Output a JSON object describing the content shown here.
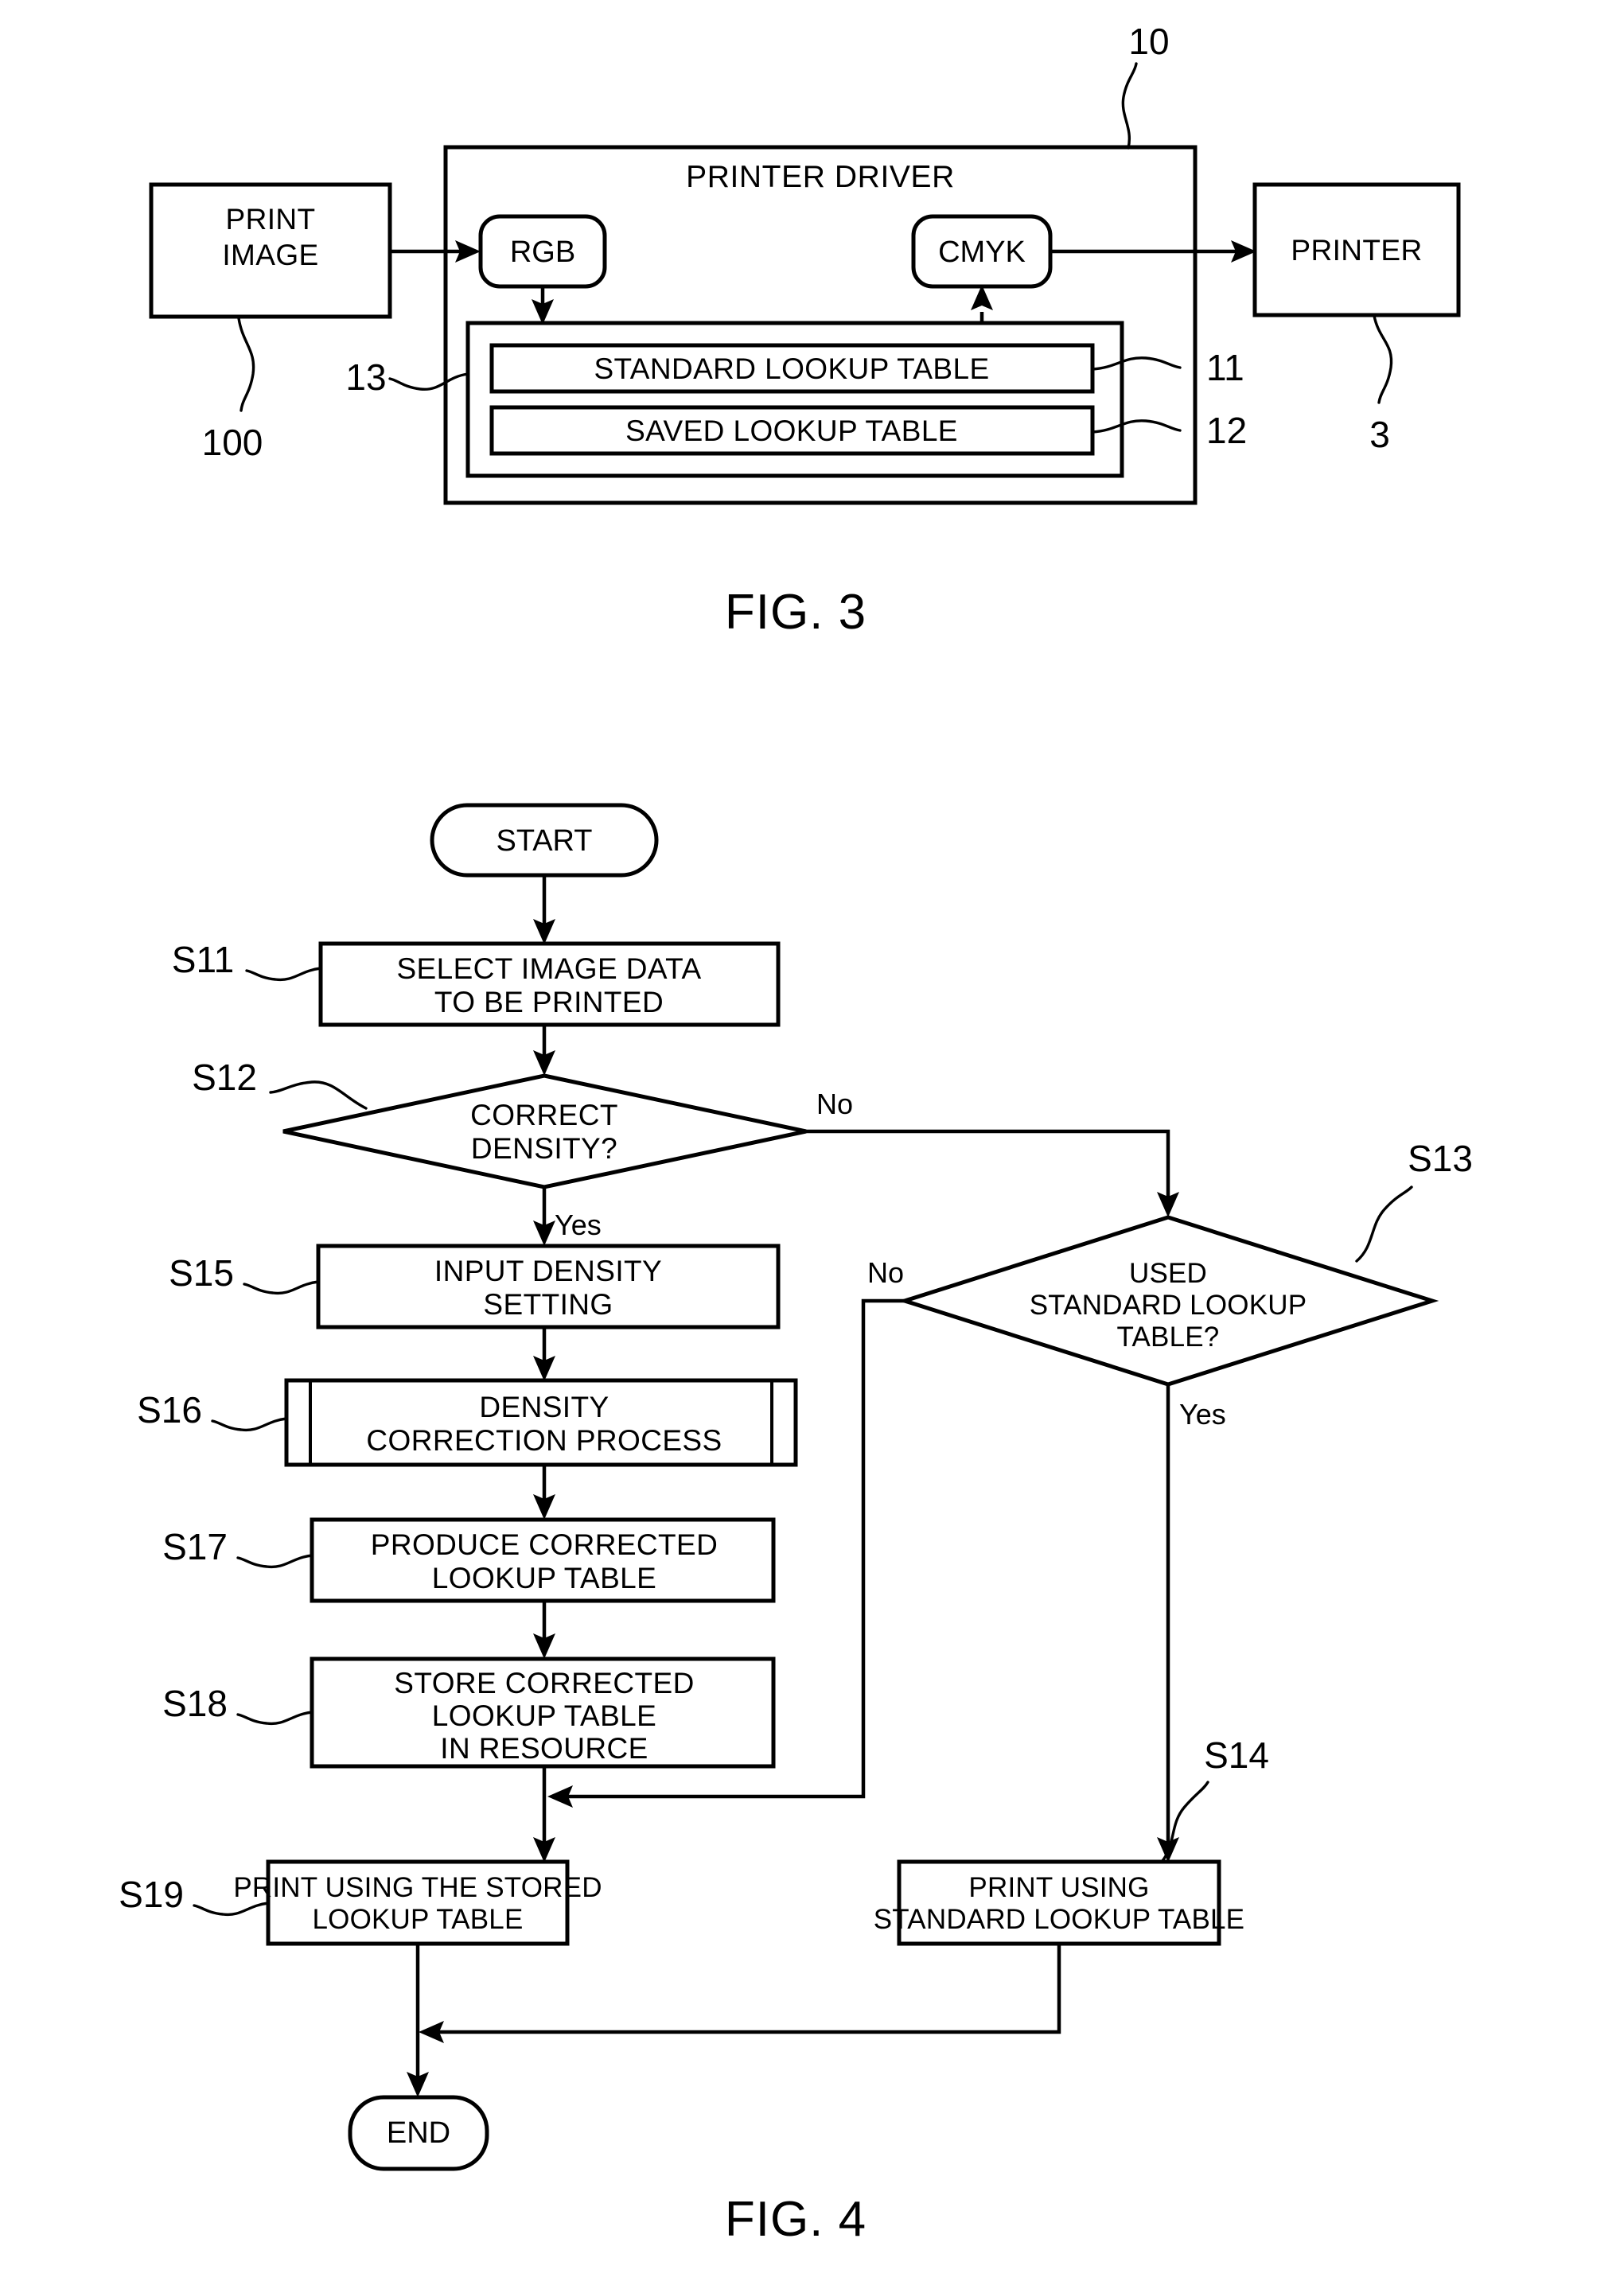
{
  "figure3": {
    "caption": "FIG. 3",
    "blocks": {
      "print_image": {
        "line1": "PRINT",
        "line2": "IMAGE",
        "ref": "100"
      },
      "printer_driver": {
        "title": "PRINTER DRIVER",
        "ref": "10"
      },
      "rgb": {
        "label": "RGB"
      },
      "cmyk": {
        "label": "CMYK"
      },
      "resource": {
        "ref": "13"
      },
      "standard_lookup_table": {
        "label": "STANDARD LOOKUP TABLE",
        "ref": "11"
      },
      "saved_lookup_table": {
        "label": "SAVED LOOKUP TABLE",
        "ref": "12"
      },
      "printer": {
        "label": "PRINTER",
        "ref": "3"
      }
    }
  },
  "figure4": {
    "caption": "FIG. 4",
    "nodes": {
      "start": {
        "label": "START"
      },
      "s11": {
        "step": "S11",
        "line1": "SELECT IMAGE DATA",
        "line2": "TO BE PRINTED"
      },
      "s12": {
        "step": "S12",
        "line1": "CORRECT",
        "line2": "DENSITY?"
      },
      "s13": {
        "step": "S13",
        "line1": "USED",
        "line2": "STANDARD LOOKUP",
        "line3": "TABLE?"
      },
      "s14": {
        "step": "S14",
        "line1": "PRINT USING",
        "line2": "STANDARD LOOKUP TABLE"
      },
      "s15": {
        "step": "S15",
        "line1": "INPUT DENSITY",
        "line2": "SETTING"
      },
      "s16": {
        "step": "S16",
        "line1": "DENSITY",
        "line2": "CORRECTION PROCESS"
      },
      "s17": {
        "step": "S17",
        "line1": "PRODUCE CORRECTED",
        "line2": "LOOKUP TABLE"
      },
      "s18": {
        "step": "S18",
        "line1": "STORE CORRECTED",
        "line2": "LOOKUP TABLE",
        "line3": "IN RESOURCE"
      },
      "s19": {
        "step": "S19",
        "line1": "PRINT USING THE STORED",
        "line2": "LOOKUP TABLE"
      },
      "end": {
        "label": "END"
      }
    },
    "branches": {
      "s12_no": "No",
      "s12_yes": "Yes",
      "s13_no": "No",
      "s13_yes": "Yes"
    }
  },
  "colors": {
    "ink": "#000000",
    "paper": "#ffffff"
  }
}
